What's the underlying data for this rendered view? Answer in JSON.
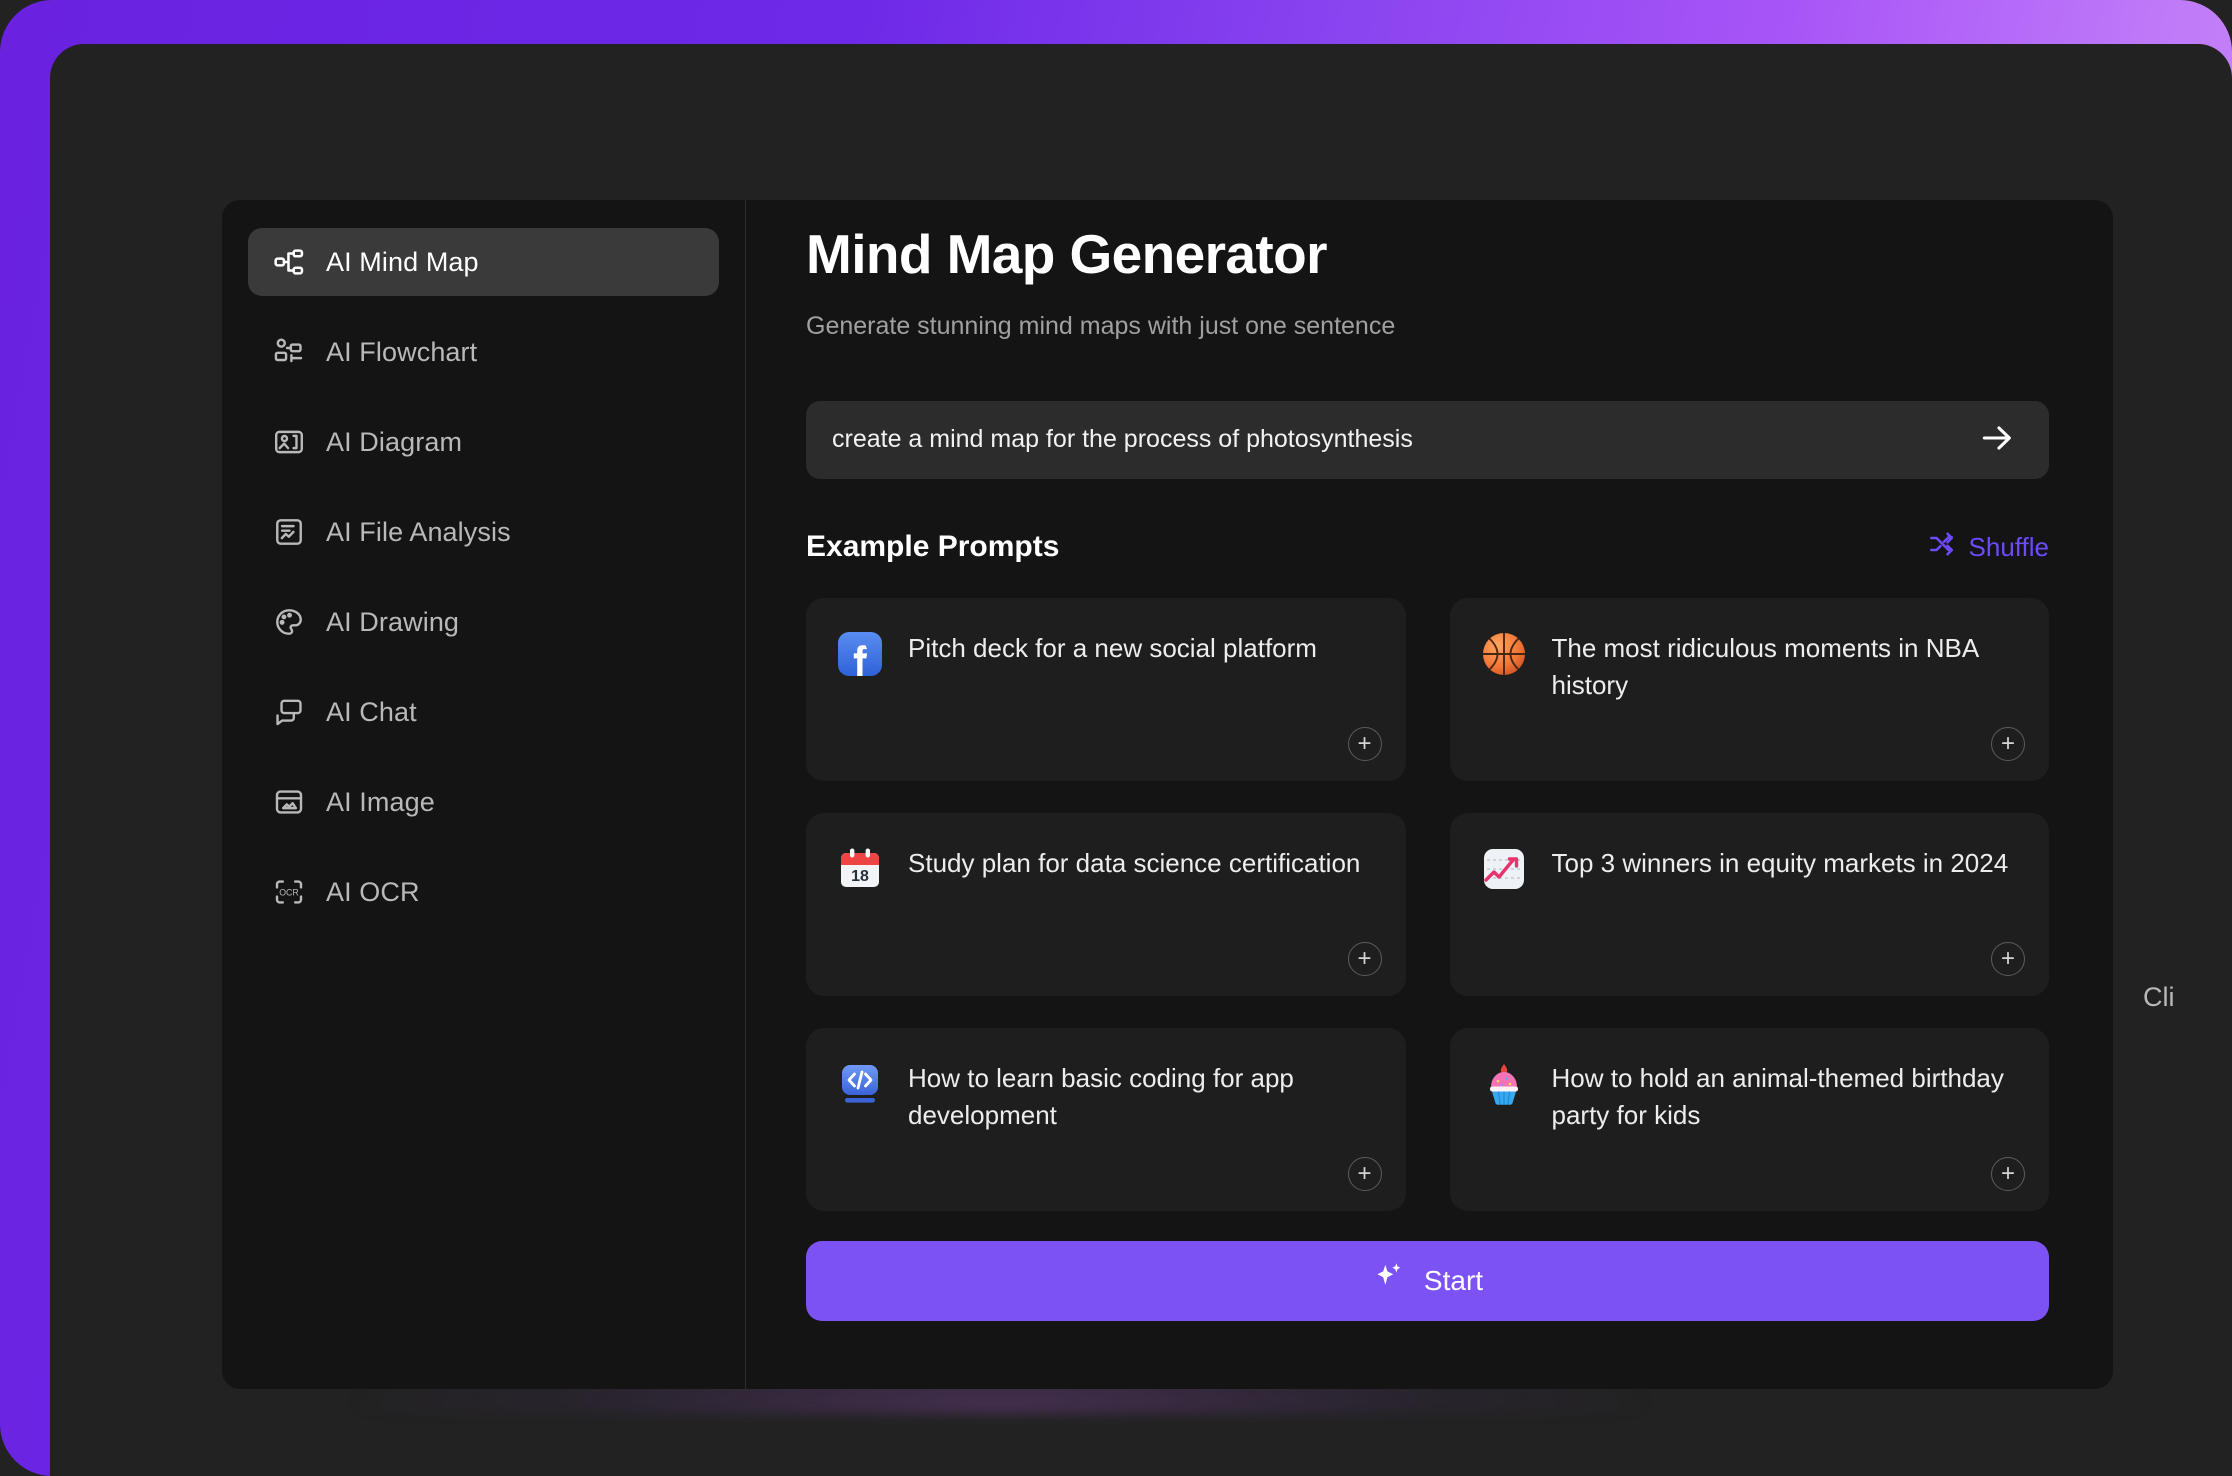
{
  "sidebar": {
    "items": [
      {
        "label": "AI Mind Map",
        "icon": "mind-map-icon",
        "active": true
      },
      {
        "label": "AI Flowchart",
        "icon": "flowchart-icon",
        "active": false
      },
      {
        "label": "AI Diagram",
        "icon": "diagram-icon",
        "active": false
      },
      {
        "label": "AI File Analysis",
        "icon": "file-analysis-icon",
        "active": false
      },
      {
        "label": "AI Drawing",
        "icon": "palette-icon",
        "active": false
      },
      {
        "label": "AI Chat",
        "icon": "chat-bubble-icon",
        "active": false
      },
      {
        "label": "AI Image",
        "icon": "image-icon",
        "active": false
      },
      {
        "label": "AI OCR",
        "icon": "ocr-icon",
        "active": false
      }
    ]
  },
  "main": {
    "title": "Mind Map Generator",
    "subtitle": "Generate stunning mind maps with just one sentence",
    "prompt": {
      "value": "create a mind map for the process of photosynthesis",
      "placeholder": "create a mind map for the process of photosynthesis",
      "submit_icon": "arrow-right-icon"
    },
    "examples": {
      "title": "Example Prompts",
      "shuffle_label": "Shuffle",
      "shuffle_icon": "shuffle-icon",
      "add_label": "+",
      "cards": [
        {
          "emoji": "facebook-icon",
          "text": "Pitch deck for a new social platform"
        },
        {
          "emoji": "basketball-icon",
          "text": "The most ridiculous moments in NBA history"
        },
        {
          "emoji": "calendar-icon",
          "text": "Study plan for data science certification"
        },
        {
          "emoji": "chart-increasing-icon",
          "text": "Top 3 winners in equity markets in 2024"
        },
        {
          "emoji": "laptop-code-icon",
          "text": "How to learn basic coding for app development"
        },
        {
          "emoji": "cupcake-icon",
          "text": "How to hold an animal-themed birthday party for kids"
        }
      ]
    },
    "start": {
      "label": "Start",
      "icon": "sparkle-icon"
    }
  },
  "clipped_label": "Cli",
  "colors": {
    "accent_purple": "#7c52f5",
    "shuffle_purple": "#6d4aff",
    "frame_gradient_start": "#6a22e0",
    "frame_gradient_end": "#cf8cfa",
    "window_bg": "#222222",
    "modal_bg": "#141414",
    "card_bg": "#1e1e1e",
    "input_bg": "#2c2c2c",
    "active_nav_bg": "#3a3a3a"
  }
}
